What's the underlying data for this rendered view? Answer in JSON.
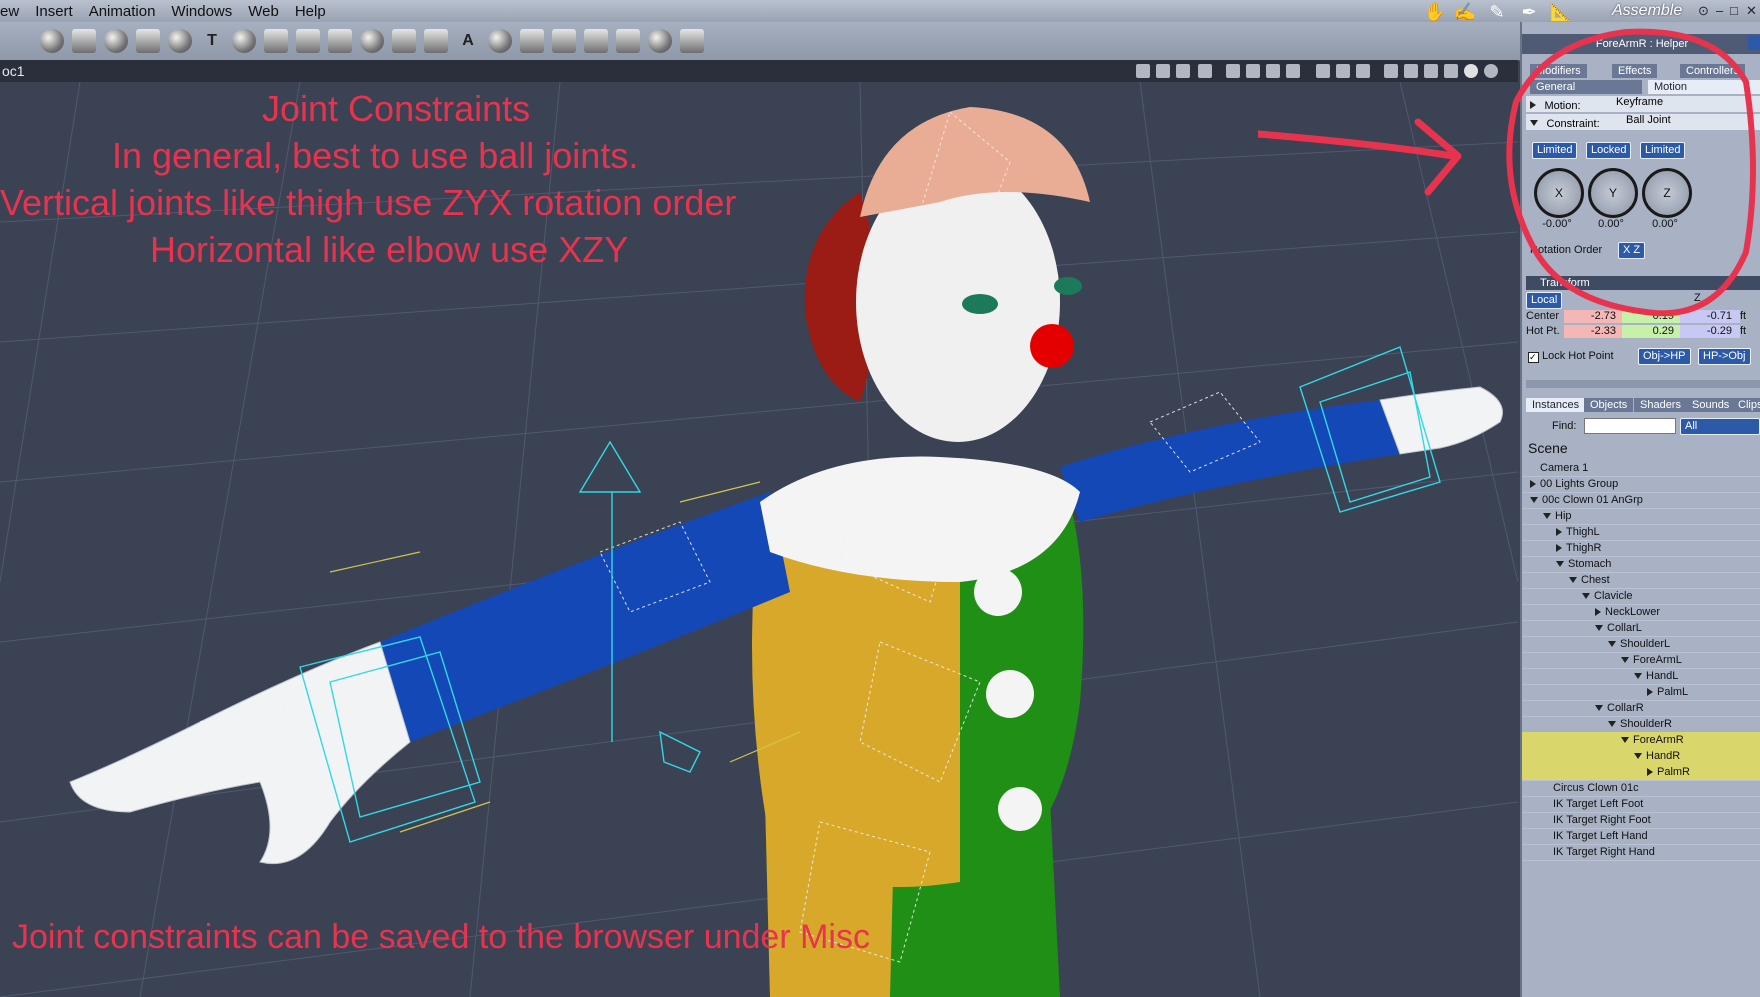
{
  "menu": [
    "ew",
    "Insert",
    "Animation",
    "Windows",
    "Web",
    "Help"
  ],
  "room": "Assemble",
  "window_controls": [
    "⊙",
    "–",
    "□",
    "✕"
  ],
  "viewport": {
    "title": "oc1"
  },
  "annotations": {
    "title": "Joint Constraints",
    "line1": "In general, best to use ball joints.",
    "line2": "Vertical joints like thigh use ZYX rotation order",
    "line3": "Horizontal like elbow use XZY",
    "footer": "Joint constraints can be saved to the browser under Misc"
  },
  "colors": {
    "annotation": "#e8334f",
    "blue_suit": "#1448b6",
    "yellow_suit": "#d8a82a",
    "green_suit": "#1f8f16",
    "selected_row": "#d9d66c"
  },
  "panel": {
    "title": "ForeArmR : Helper",
    "tabs_top": [
      "Modifiers",
      "Effects",
      "Controllers"
    ],
    "tabs_bottom": [
      "General",
      "Motion"
    ],
    "motion_label": "Motion:",
    "motion_value": "Keyframe",
    "constraint_label": "Constraint:",
    "constraint_value": "Ball Joint",
    "limits": [
      "Limited",
      "Locked",
      "Limited"
    ],
    "dials": [
      {
        "axis": "X",
        "value": "-0.00°"
      },
      {
        "axis": "Y",
        "value": "0.00°"
      },
      {
        "axis": "Z",
        "value": "0.00°"
      }
    ],
    "rotation_order_label": "Rotation Order",
    "rotation_order_value": "X Z",
    "transform_title": "Transform",
    "space": "Local",
    "z_header": "Z",
    "center_label": "Center",
    "center": [
      "-2.73",
      "0.19",
      "-0.71"
    ],
    "hotpt_label": "Hot Pt.",
    "hotpt": [
      "-2.33",
      "0.29",
      "-0.29"
    ],
    "unit": "ft",
    "lock_label": "Lock Hot Point",
    "obj_hp": "Obj->HP",
    "hp_obj": "HP->Obj"
  },
  "scene": {
    "tabs": [
      "Instances",
      "Objects",
      "Shaders",
      "Sounds",
      "Clips"
    ],
    "find_label": "Find:",
    "filter": "All",
    "header": "Scene",
    "items": [
      {
        "label": "Camera 1",
        "depth": 0,
        "toggle": "none"
      },
      {
        "label": "00 Lights Group",
        "depth": 0,
        "toggle": "closed"
      },
      {
        "label": "00c Clown 01 AnGrp",
        "depth": 0,
        "toggle": "open"
      },
      {
        "label": "Hip",
        "depth": 1,
        "toggle": "open"
      },
      {
        "label": "ThighL",
        "depth": 2,
        "toggle": "closed"
      },
      {
        "label": "ThighR",
        "depth": 2,
        "toggle": "closed"
      },
      {
        "label": "Stomach",
        "depth": 2,
        "toggle": "open"
      },
      {
        "label": "Chest",
        "depth": 3,
        "toggle": "open"
      },
      {
        "label": "Clavicle",
        "depth": 4,
        "toggle": "open"
      },
      {
        "label": "NeckLower",
        "depth": 5,
        "toggle": "closed"
      },
      {
        "label": "CollarL",
        "depth": 5,
        "toggle": "open"
      },
      {
        "label": "ShoulderL",
        "depth": 6,
        "toggle": "open"
      },
      {
        "label": "ForeArmL",
        "depth": 7,
        "toggle": "open"
      },
      {
        "label": "HandL",
        "depth": 8,
        "toggle": "open"
      },
      {
        "label": "PalmL",
        "depth": 9,
        "toggle": "closed"
      },
      {
        "label": "CollarR",
        "depth": 5,
        "toggle": "open"
      },
      {
        "label": "ShoulderR",
        "depth": 6,
        "toggle": "open"
      },
      {
        "label": "ForeArmR",
        "depth": 7,
        "toggle": "open",
        "selected": true
      },
      {
        "label": "HandR",
        "depth": 8,
        "toggle": "open",
        "selected": true
      },
      {
        "label": "PalmR",
        "depth": 9,
        "toggle": "closed",
        "selected": true
      },
      {
        "label": "Circus Clown 01c",
        "depth": 1,
        "toggle": "none"
      },
      {
        "label": "IK Target Left Foot",
        "depth": 1,
        "toggle": "none"
      },
      {
        "label": "IK Target Right Foot",
        "depth": 1,
        "toggle": "none"
      },
      {
        "label": "IK Target Left Hand",
        "depth": 1,
        "toggle": "none"
      },
      {
        "label": "IK Target Right Hand",
        "depth": 1,
        "toggle": "none"
      }
    ]
  }
}
